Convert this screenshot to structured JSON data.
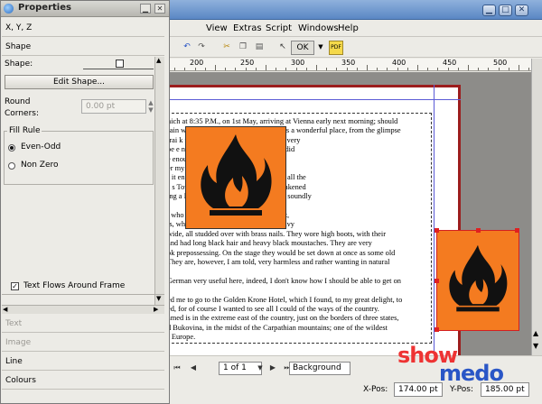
{
  "properties": {
    "title": "Properties",
    "tabs": {
      "xyz": "X, Y, Z",
      "shape": "Shape",
      "text": "Text",
      "image": "Image",
      "line": "Line",
      "colours": "Colours"
    },
    "shape_label": "Shape:",
    "edit_shape_button": "Edit Shape...",
    "round_label_1": "Round",
    "round_label_2": "Corners:",
    "round_value": "0.00 pt",
    "fill_rule_title": "Fill Rule",
    "even_odd": "Even-Odd",
    "non_zero": "Non Zero",
    "text_flows_label": "Text Flows Around Frame"
  },
  "main": {
    "menu": [
      "View",
      "Extras",
      "Script",
      "Windows",
      "Help"
    ],
    "toolbar": {
      "ok_label": "OK",
      "pdf_label": "PDF"
    },
    "ruler_labels": [
      "200",
      "250",
      "300",
      "350",
      "400",
      "450",
      "500"
    ],
    "text_lines": [
      "nich at 8:35 P.M., on 1st May, arriving at Vienna early next morning; should",
      "rain was an hour late. Buda-Pesth seems a wonderful place, from the glimpse",
      "trai                                  k through the streets. I feared to go very",
      "be                                   e near the correct time as possible I did",
      "                                      e enough, for I had all sorts of queer",
      "                                      er my window, which may have had",
      "r it                                  en the paprika, for I had to drink up all the",
      "s s                                   Towards morning I slept and was wakened",
      "ing a                                 I guess I must have been sleeping soundly",
      "",
      "                                      , who were more barbarian than the rest,",
      "is,                                   white linen shirts, and enormous heavy",
      " wide, all studded over with brass nails. They wore high boots, with their",
      "and had long black hair and heavy black moustaches. They are very",
      "ok prepossessing. On the stage they would be set down at once as some old",
      "They are, however, I am told, very harmless and rather wanting in natural",
      "",
      "German very useful here, indeed, I don't know how I should be able to get on",
      "",
      "ed me to go to the Golden Krone Hotel, which I found, to my great delight, to",
      "ed, for of course I wanted to see all I could of the ways of the country.",
      "amed is in the extreme east of the country, just on the borders of three states,",
      "d Bukovina, in the midst of the Carpathian mountains; one of the wildest",
      "f Europe."
    ],
    "page_select": "1 of 1",
    "layer_select": "Background",
    "x_pos_label": "X-Pos:",
    "x_pos_value": "174.00 pt",
    "y_pos_label": "Y-Pos:",
    "y_pos_value": "185.00 pt",
    "logo_show": "show",
    "logo_medo": "medo"
  },
  "colors": {
    "fire_bg": "#f47b20",
    "selection": "#e02020",
    "page_border": "#9c1d1d"
  },
  "icons": [
    "fire-icon",
    "close-icon",
    "maximize-icon",
    "minimize-icon",
    "radio-button-icon",
    "checkbox-icon",
    "scroll-arrow-icon"
  ]
}
